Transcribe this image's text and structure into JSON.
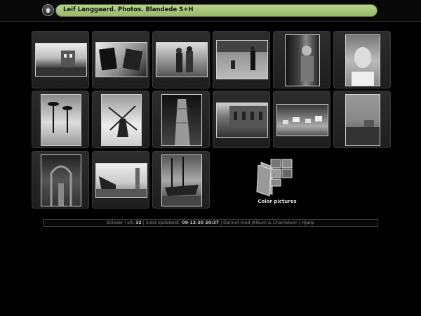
{
  "header": {
    "title": "Leif Langgaard. Photos. Blandede S+H"
  },
  "thumbnails": [
    {
      "icon": "ruined-building-photo"
    },
    {
      "icon": "tilted-frames-photo"
    },
    {
      "icon": "two-men-graffiti-photo"
    },
    {
      "icon": "people-on-lawn-photo"
    },
    {
      "icon": "woman-in-coat-photo"
    },
    {
      "icon": "smiling-girl-portrait-photo"
    },
    {
      "icon": "palm-trees-beach-photo"
    },
    {
      "icon": "windmill-photo"
    },
    {
      "icon": "brick-tower-photo"
    },
    {
      "icon": "arched-building-street-photo"
    },
    {
      "icon": "hillside-village-photo"
    },
    {
      "icon": "stone-wall-tower-photo"
    },
    {
      "icon": "garden-arch-photo"
    },
    {
      "icon": "boat-and-minaret-photo"
    },
    {
      "icon": "sailing-ship-harbor-photo"
    }
  ],
  "folder": {
    "label": "Color pictures",
    "icon": "photo-album-folder-icon"
  },
  "footer": {
    "label_total": "Billeder i alt:",
    "total": "32",
    "sep1": " | ",
    "label_updated": "Sidst opdateret:",
    "updated": "09-12-20 20:37",
    "sep2": " | ",
    "made_with": "Dannet med",
    "link_jalbum": "jAlbum",
    "amp": " & ",
    "link_skin": "Chameleon",
    "sep3": " | ",
    "link_help": "Hjælp"
  }
}
